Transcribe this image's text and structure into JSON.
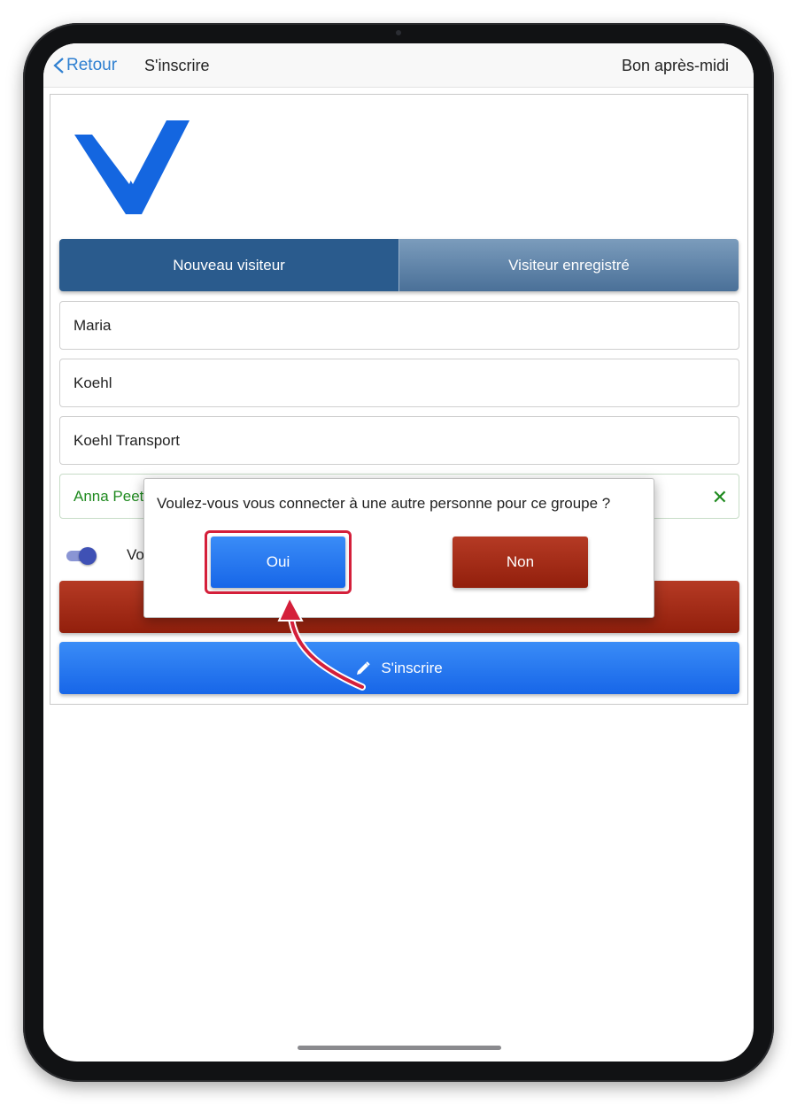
{
  "navbar": {
    "back_label": "Retour",
    "title": "S'inscrire",
    "greeting": "Bon après-midi"
  },
  "tabs": [
    {
      "label": "Nouveau visiteur",
      "active": true
    },
    {
      "label": "Visiteur enregistré",
      "active": false
    }
  ],
  "form": {
    "first_name": "Maria",
    "last_name": "Koehl",
    "company": "Koehl Transport",
    "host": "Anna Peet",
    "toggle_label": "Vo",
    "toggle_on": true
  },
  "register_label": "S'inscrire",
  "modal": {
    "question": "Voulez-vous vous connecter à une autre personne pour ce groupe ?",
    "yes_label": "Oui",
    "no_label": "Non"
  },
  "colors": {
    "accent_blue": "#1e78f0",
    "nav_blue": "#2a5b8d",
    "danger_red": "#a32a14",
    "success_green": "#1f8a1f",
    "annotation_red": "#d41f3a"
  },
  "icons": {
    "back": "chevron-left-icon",
    "clear": "close-icon",
    "register": "pencil-icon"
  }
}
